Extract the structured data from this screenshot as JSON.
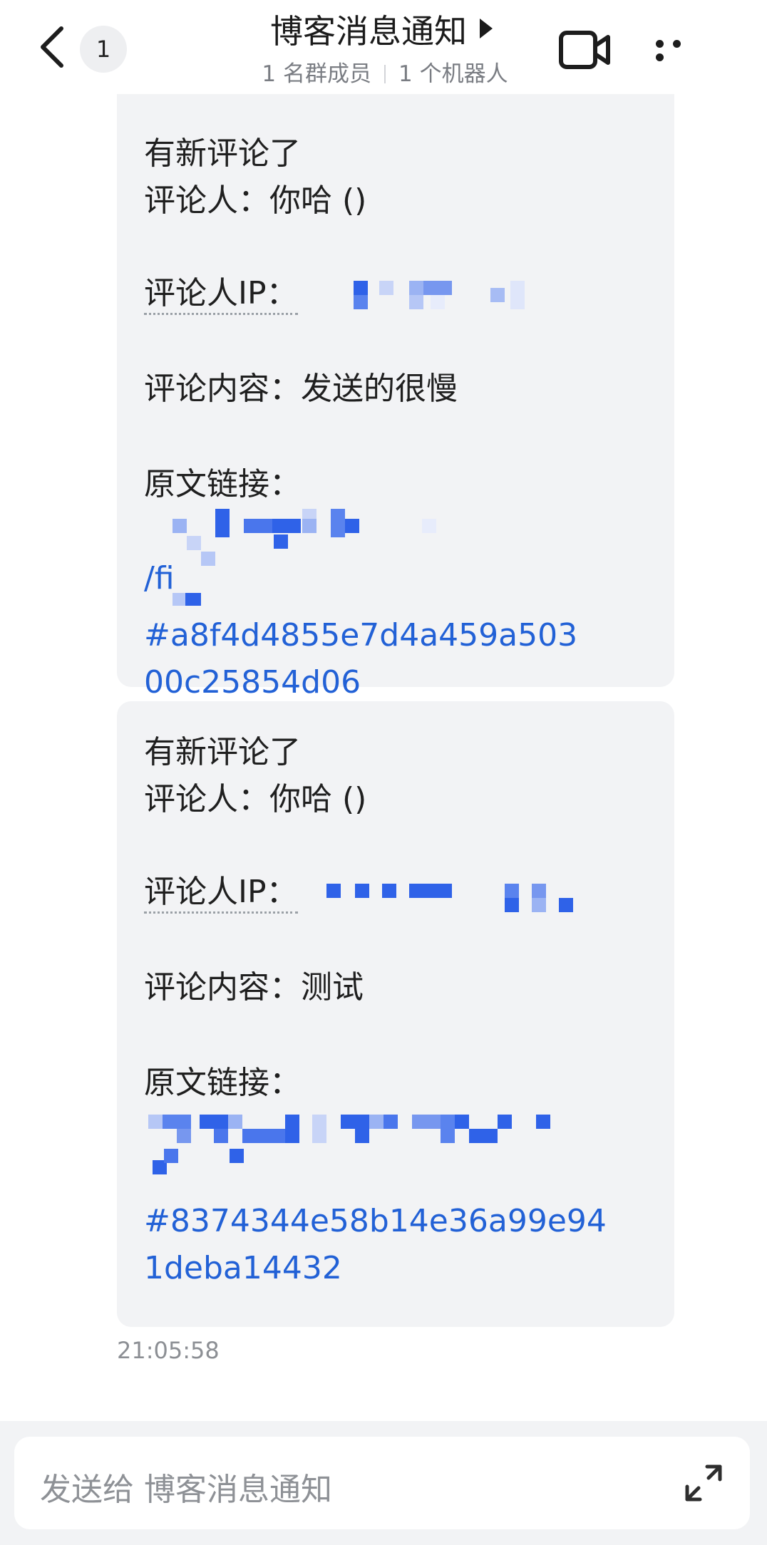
{
  "header": {
    "back_label": "返回",
    "unread_count": "1",
    "title": "博客消息通知",
    "member_count": "1 名群成员",
    "bot_count": "1 个机器人",
    "video_icon": "video-camera-icon",
    "more_icon": "more-dots-icon"
  },
  "messages": [
    {
      "heading": "有新评论了",
      "commenter": "评论人：你哈 ()",
      "ip_label": "评论人IP：",
      "content": "评论内容：发送的很慢",
      "link_label": "原文链接：",
      "link_fragment": "/fi",
      "link_hash": "#a8f4d4855e7d4a459a503",
      "link_hash_end": "00c25854d06"
    },
    {
      "heading": "有新评论了",
      "commenter": "评论人：你哈 ()",
      "ip_label": "评论人IP：",
      "content": "评论内容：测试",
      "link_label": "原文链接：",
      "link_hash": "#8374344e58b14e36a99e94",
      "link_hash_end": "1deba14432"
    }
  ],
  "timestamp": "21:05:58",
  "input": {
    "placeholder": "发送给 博客消息通知",
    "expand_icon": "expand-icon"
  },
  "colors": {
    "link": "#2261d6",
    "bubble": "#f2f3f5",
    "mosaic": "#2f62e8"
  }
}
